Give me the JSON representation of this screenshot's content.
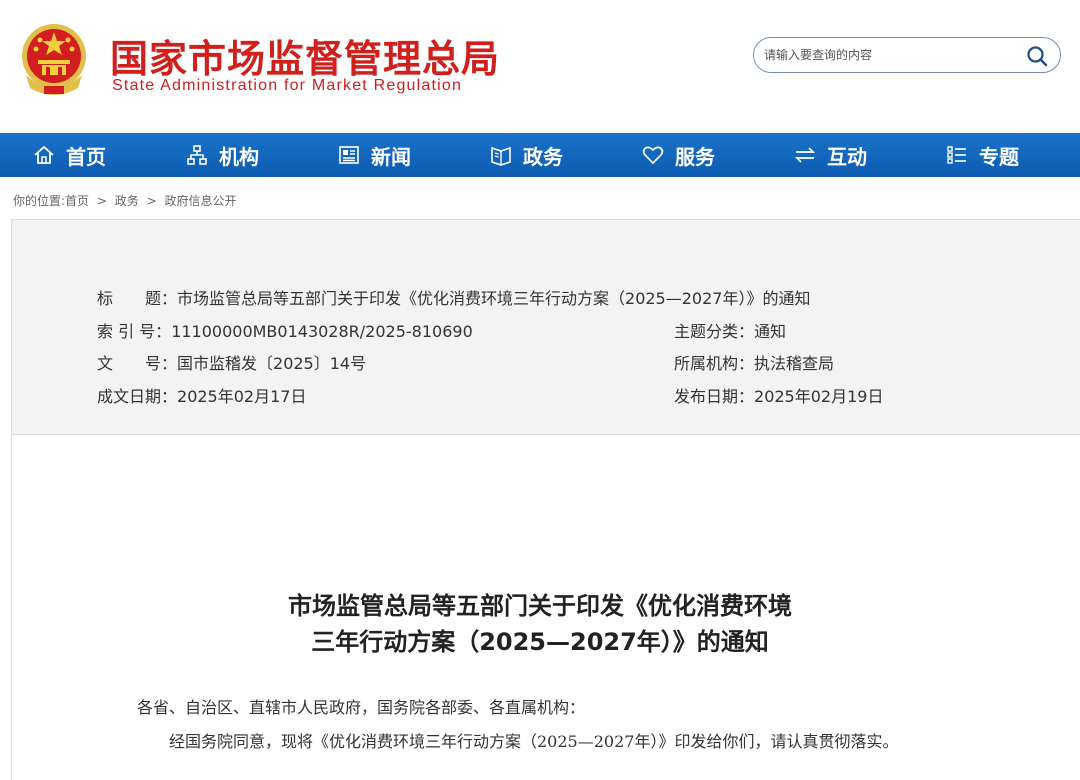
{
  "header": {
    "title_cn": "国家市场监督管理总局",
    "title_en": "State Administration for Market Regulation",
    "emblem_icon": "national-emblem-icon"
  },
  "search": {
    "placeholder": "请输入要查询的内容",
    "icon": "search-icon"
  },
  "nav": {
    "items": [
      {
        "label": "首页",
        "icon": "home-icon"
      },
      {
        "label": "机构",
        "icon": "org-chart-icon"
      },
      {
        "label": "新闻",
        "icon": "newspaper-icon"
      },
      {
        "label": "政务",
        "icon": "open-book-icon"
      },
      {
        "label": "服务",
        "icon": "heart-icon"
      },
      {
        "label": "互动",
        "icon": "swap-arrows-icon"
      },
      {
        "label": "专题",
        "icon": "list-icon"
      }
    ],
    "background": "#1167c0"
  },
  "breadcrumb": {
    "prefix": "你的位置:",
    "items": [
      "首页",
      "政务",
      "政府信息公开"
    ],
    "separator": ">"
  },
  "meta": {
    "title_label": "标　　题：",
    "title_value": "市场监管总局等五部门关于印发《优化消费环境三年行动方案（2025—2027年）》的通知",
    "index_label": "索 引 号：",
    "index_value": "11100000MB0143028R/2025-810690",
    "topic_label": "主题分类：",
    "topic_value": "通知",
    "docno_label": "文　　号：",
    "docno_value": "国市监稽发〔2025〕14号",
    "org_label": "所属机构：",
    "org_value": "执法稽查局",
    "written_label": "成文日期：",
    "written_value": "2025年02月17日",
    "published_label": "发布日期：",
    "published_value": "2025年02月19日"
  },
  "document": {
    "title_line1": "市场监管总局等五部门关于印发《优化消费环境",
    "title_line2": "三年行动方案（2025—2027年）》的通知",
    "salutation": "各省、自治区、直辖市人民政府，国务院各部委、各直属机构：",
    "body": "经国务院同意，现将《优化消费环境三年行动方案（2025—2027年）》印发给你们，请认真贯彻落实。"
  },
  "colors": {
    "brand_red": "#d11f1c",
    "nav_blue": "#1167c0",
    "meta_bg": "#f3f3f3"
  }
}
